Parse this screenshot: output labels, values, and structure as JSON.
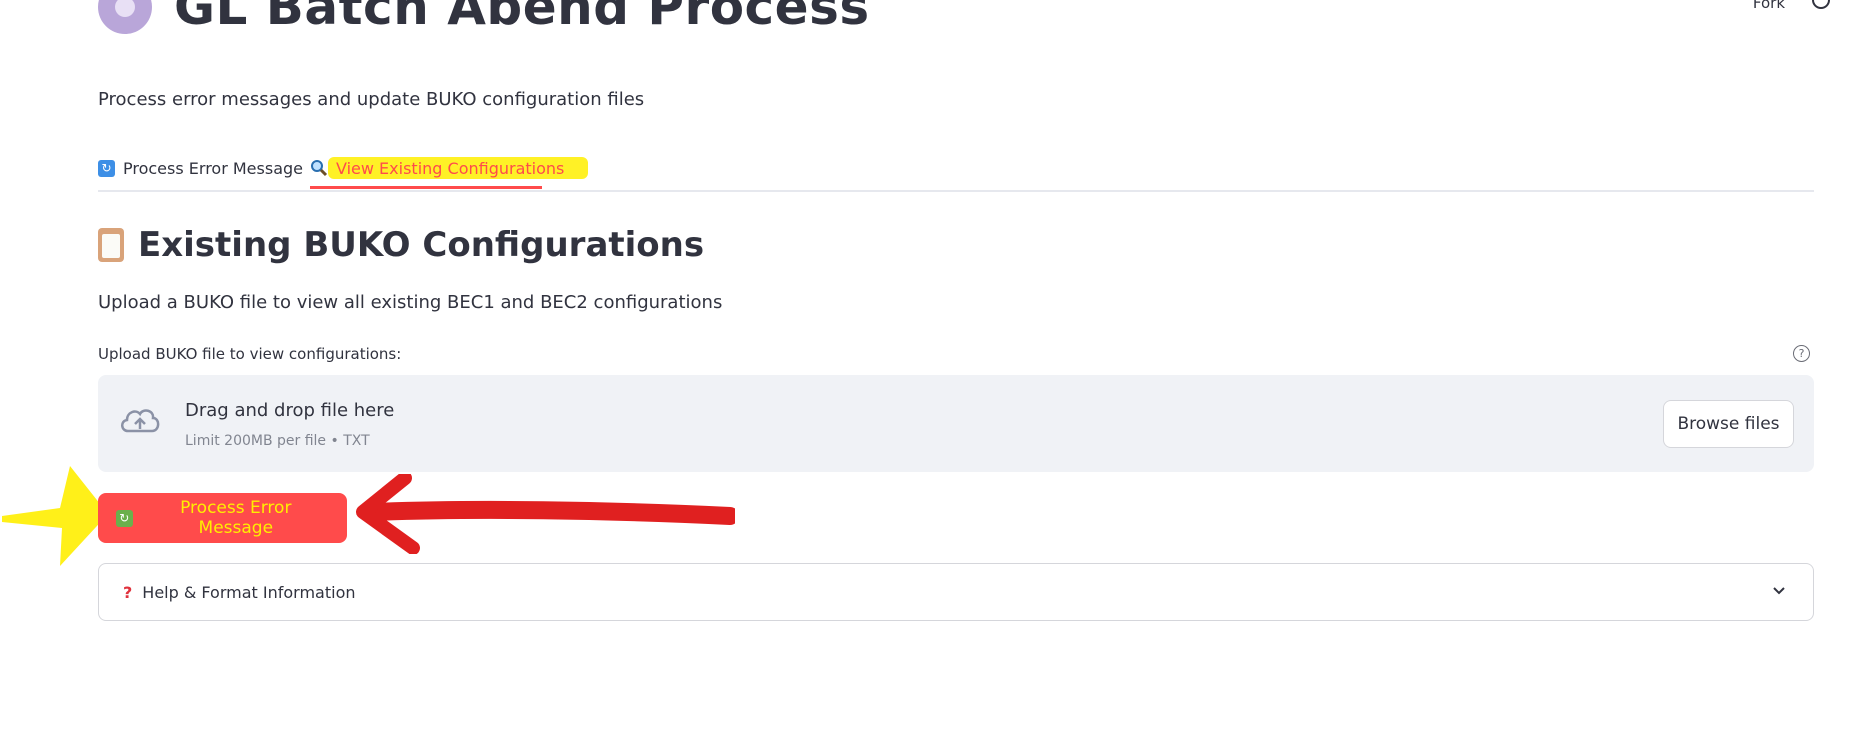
{
  "header": {
    "fork_label": "Fork",
    "menu_icon": "github-icon"
  },
  "app": {
    "title": "GL Batch Abend Process",
    "title_icon": "gear-icon",
    "subtitle": "Process error messages and update BUKO configuration files"
  },
  "tabs": [
    {
      "label": "Process Error Message",
      "icon": "refresh-icon",
      "active": false
    },
    {
      "label": "View Existing Configurations",
      "icon": "magnifier-icon",
      "active": true
    }
  ],
  "section": {
    "icon": "clipboard-icon",
    "title": "Existing BUKO Configurations",
    "description": "Upload a BUKO file to view all existing BEC1 and BEC2 configurations"
  },
  "uploader": {
    "label": "Upload BUKO file to view configurations:",
    "drop_title": "Drag and drop file here",
    "limit_text": "Limit 200MB per file • TXT",
    "browse_label": "Browse files"
  },
  "process_button": {
    "label": "Process Error Message",
    "icon": "refresh-icon"
  },
  "expander": {
    "label": "Help & Format Information",
    "icon": "question-icon"
  },
  "colors": {
    "accent": "#ff4b4b",
    "highlight": "#ffee00",
    "annotation_red": "#e02020",
    "dropzone_bg": "#f0f2f6"
  }
}
